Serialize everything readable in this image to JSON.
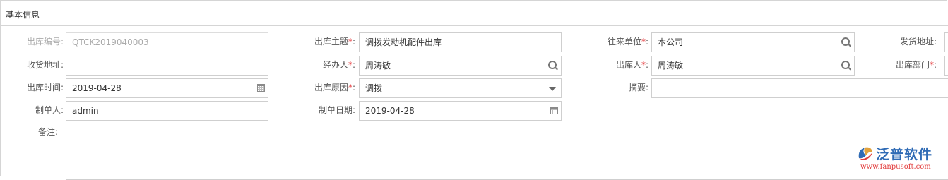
{
  "panel": {
    "title": "基本信息"
  },
  "required_mark": "*",
  "fields": {
    "outbound_no": {
      "label": "出库编号:",
      "value": "QTCK2019040003"
    },
    "outbound_subject": {
      "label": "出库主题",
      "value": "调拨发动机配件出库"
    },
    "counterparty": {
      "label": "往来单位",
      "value": "本公司"
    },
    "ship_address": {
      "label": "发货地址:",
      "value": ""
    },
    "receive_address": {
      "label": "收货地址:",
      "value": ""
    },
    "handler": {
      "label": "经办人",
      "value": "周涛敏"
    },
    "outbound_person": {
      "label": "出库人",
      "value": "周涛敏"
    },
    "outbound_dept": {
      "label": "出库部门",
      "value": ""
    },
    "outbound_time": {
      "label": "出库时间:",
      "value": "2019-04-28"
    },
    "outbound_reason": {
      "label": "出库原因",
      "value": "调拨"
    },
    "summary": {
      "label": "摘要:",
      "value": ""
    },
    "creator": {
      "label": "制单人:",
      "value": "admin"
    },
    "create_date": {
      "label": "制单日期:",
      "value": "2019-04-28"
    },
    "remarks": {
      "label": "备注:",
      "value": ""
    }
  },
  "colon": ":",
  "watermark": {
    "name": "泛普软件",
    "url": "www.fanpusoft.com"
  },
  "colors": {
    "required": "#e4393c",
    "logo_blue": "#2f6bb5",
    "logo_red": "#e23c3c"
  }
}
